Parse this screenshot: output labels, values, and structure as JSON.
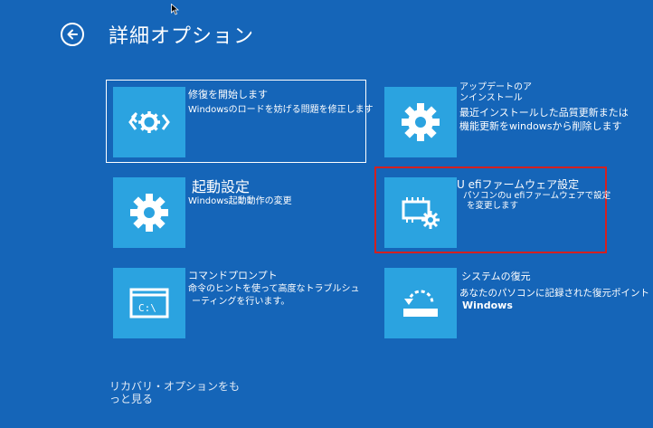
{
  "header": {
    "title": "詳細オプション"
  },
  "options": [
    {
      "id": "startup-repair",
      "title": "修復を開始します",
      "desc": [
        "Windowsのロードを妨げる問題を修正します"
      ]
    },
    {
      "id": "uninstall-updates",
      "title": "アップデートのア\nンインストール",
      "desc": [
        "最近インストールした品質更新または",
        "機能更新をwindowsから削除します"
      ]
    },
    {
      "id": "startup-settings",
      "title": "起動設定",
      "desc": [
        "Windows起動動作の変更"
      ]
    },
    {
      "id": "uefi-settings",
      "title": "U efiファームウェア設定",
      "desc": [
        "パソコンのu efiファームウェアで設定",
        "を変更します"
      ]
    },
    {
      "id": "command-prompt",
      "title": "コマンドプロンプト",
      "desc": [
        "命令のヒントを使って高度なトラブルシュ",
        "ーティングを行います。"
      ]
    },
    {
      "id": "system-restore",
      "title": "システムの復元",
      "desc": [
        "あなたのパソコンに記録された復元ポイント",
        "Windows"
      ]
    }
  ],
  "footer": {
    "more_line1": "リカバリ・オプションをも",
    "more_line2": "っと見る"
  },
  "icons": {
    "back": "back-arrow-icon",
    "repair": "repair-gear-icon",
    "gear": "gear-icon",
    "uefi": "chip-gear-icon",
    "cmd": "command-prompt-icon",
    "restore": "system-restore-icon"
  },
  "colors": {
    "background": "#1565b8",
    "tile": "#2ba3e0",
    "highlight": "#d42020"
  }
}
